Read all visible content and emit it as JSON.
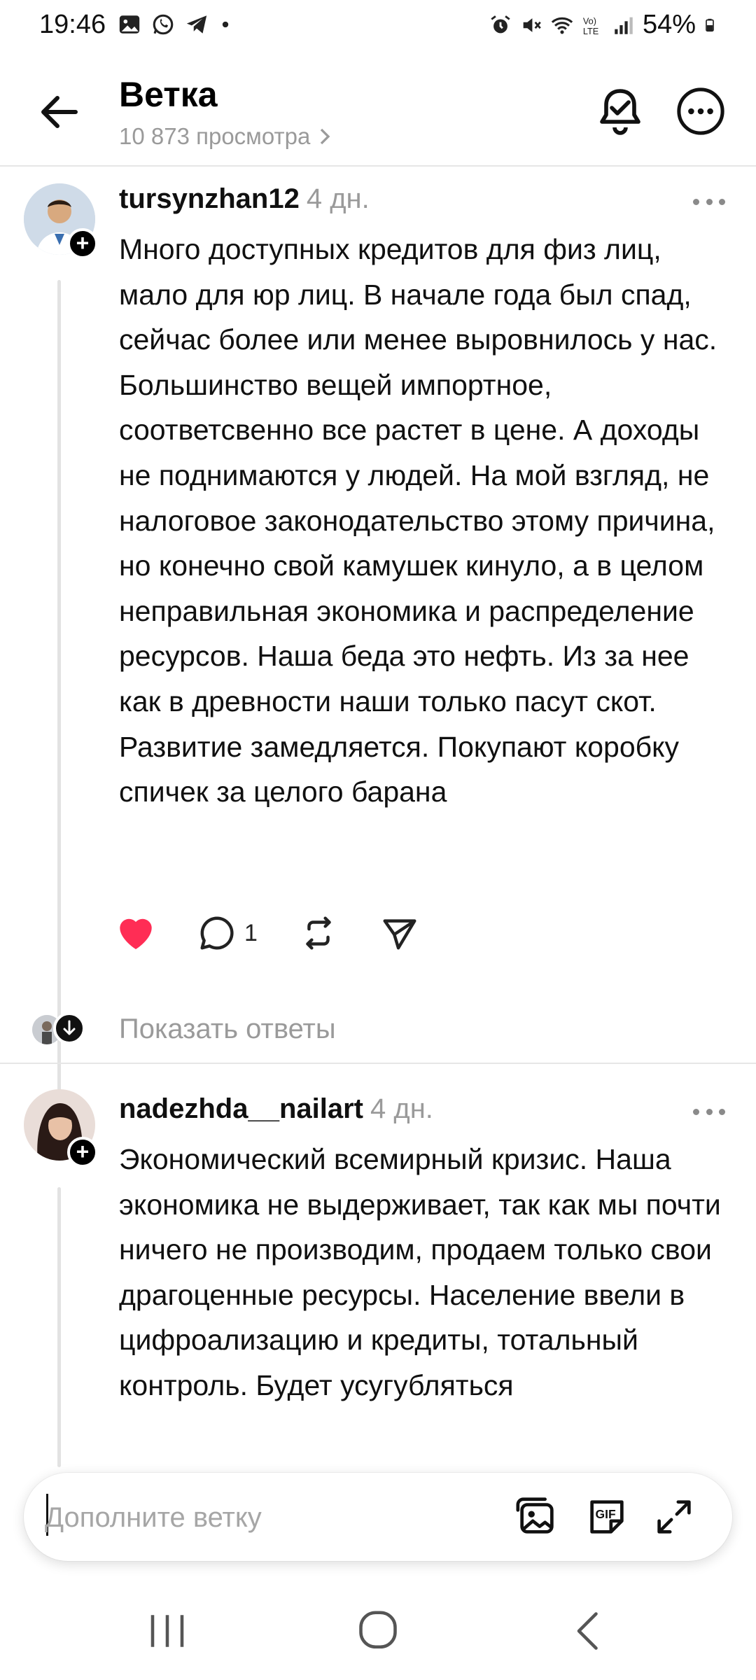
{
  "status_bar": {
    "time": "19:46",
    "battery": "54%",
    "left_icons": [
      "gallery-icon",
      "whatsapp-icon",
      "telegram-icon",
      "dot-icon"
    ],
    "right_icons": [
      "alarm-icon",
      "mute-icon",
      "wifi-icon",
      "volte-icon",
      "signal-icon",
      "battery-icon"
    ]
  },
  "header": {
    "title": "Ветка",
    "views": "10 873 просмотра"
  },
  "posts": [
    {
      "username": "tursynzhan12",
      "time": "4 дн.",
      "text": "Много доступных кредитов для физ лиц, мало для юр лиц. В начале года был спад, сейчас более или менее выровнилось у нас. Большинство вещей импортное, соответсвенно все растет в цене. А доходы не поднимаются у людей. На мой взгляд, не налоговое законодательство этому причина, но конечно свой камушек кинуло, а в целом неправильная экономика и распределение ресурсов. Наша беда это нефть. Из за нее как в древности наши только пасут скот. Развитие замедляется. Покупают коробку спичек за целого барана",
      "liked": true,
      "reply_count": "1",
      "show_replies_label": "Показать ответы"
    },
    {
      "username": "nadezhda__nailart",
      "time": "4 дн.",
      "text": "Экономический всемирный  кризис. Наша экономика не выдерживает, так как мы почти ничего не производим, продаем только свои драгоценные ресурсы. Население ввели в цифроализацию и кредиты, тотальный контроль. Будет усугубляться"
    }
  ],
  "composer": {
    "placeholder": "Дополните ветку"
  },
  "colors": {
    "like": "#ff2d55",
    "muted_text": "#9a9a9a",
    "divider": "#e6e6e6"
  }
}
